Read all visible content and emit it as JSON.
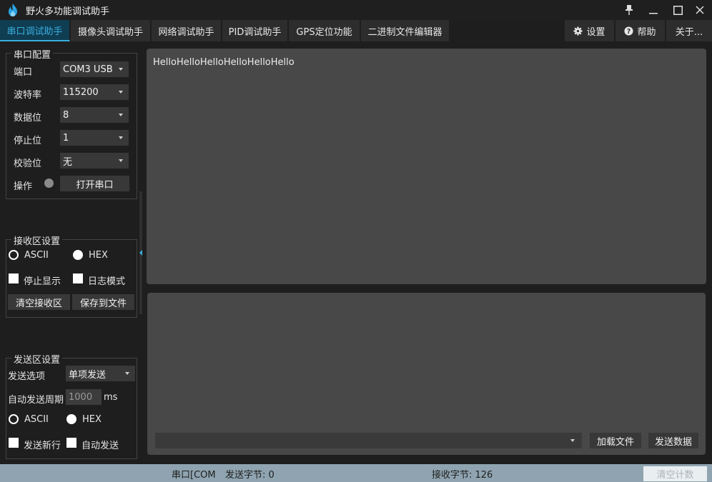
{
  "app": {
    "title": "野火多功能调试助手"
  },
  "tabs": [
    {
      "label": "串口调试助手"
    },
    {
      "label": "摄像头调试助手"
    },
    {
      "label": "网络调试助手"
    },
    {
      "label": "PID调试助手"
    },
    {
      "label": "GPS定位功能"
    },
    {
      "label": "二进制文件编辑器"
    }
  ],
  "right_tabs": {
    "settings": "设置",
    "help": "帮助",
    "about": "关于..."
  },
  "serial_config": {
    "title": "串口配置",
    "port_label": "端口",
    "port_value": "COM3 USB",
    "baud_label": "波特率",
    "baud_value": "115200",
    "data_bits_label": "数据位",
    "data_bits_value": "8",
    "stop_bits_label": "停止位",
    "stop_bits_value": "1",
    "parity_label": "校验位",
    "parity_value": "无",
    "operation_label": "操作",
    "open_button": "打开串口"
  },
  "receive_settings": {
    "title": "接收区设置",
    "ascii": "ASCII",
    "hex": "HEX",
    "stop_display": "停止显示",
    "log_mode": "日志模式",
    "clear_button": "清空接收区",
    "save_button": "保存到文件"
  },
  "send_settings": {
    "title": "发送区设置",
    "option_label": "发送选项",
    "option_value": "单项发送",
    "period_label": "自动发送周期",
    "period_value": "1000",
    "period_unit": "ms",
    "ascii": "ASCII",
    "hex": "HEX",
    "newline": "发送新行",
    "auto_send": "自动发送"
  },
  "receive_area": {
    "text": "HelloHelloHelloHelloHelloHello"
  },
  "send_area": {
    "load_file": "加载文件",
    "send_data": "发送数据"
  },
  "status": {
    "port": "串口[COM",
    "sent_bytes": "发送字节: 0",
    "recv_bytes": "接收字节: 126",
    "clear_count": "清空计数"
  },
  "colors": {
    "accent": "#3aaee0",
    "status_bar": "#8fa4b0"
  }
}
